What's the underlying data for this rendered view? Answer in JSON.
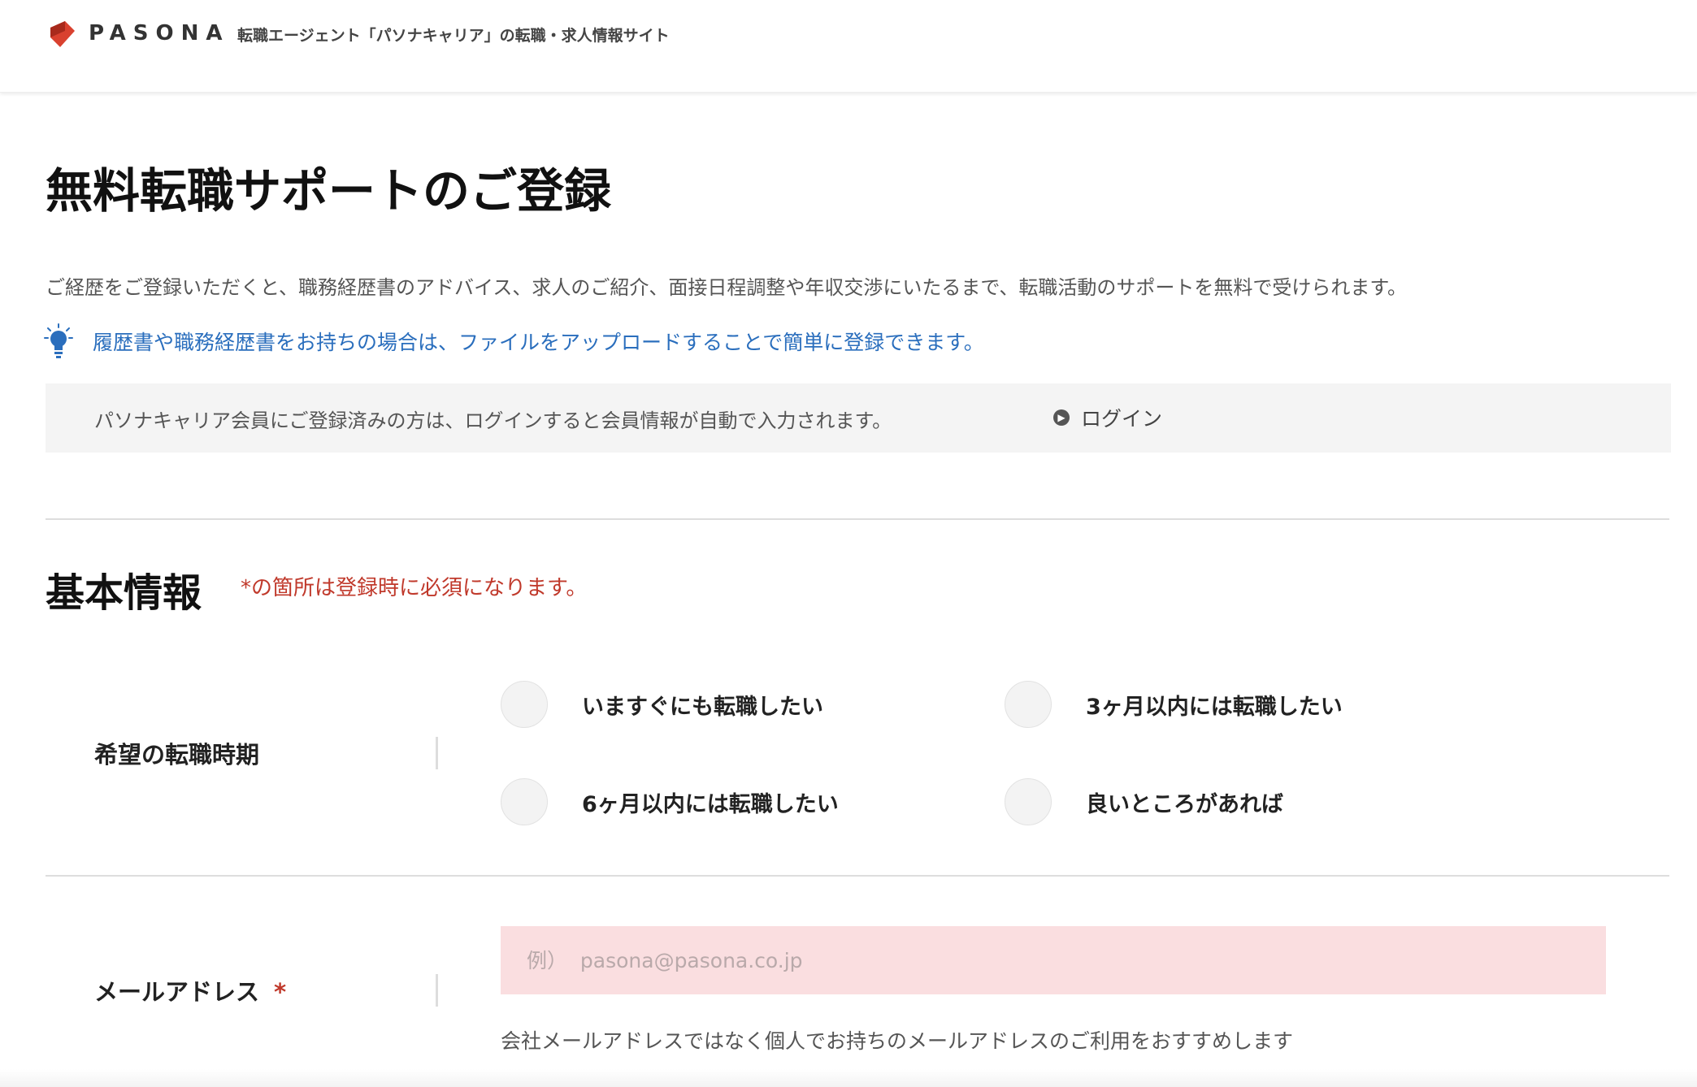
{
  "header": {
    "logo_text": "PASONA",
    "logo_icon": "pasona-logo-mark",
    "tagline": "転職エージェント「パソナキャリア」の転職・求人情報サイト"
  },
  "main": {
    "title": "無料転職サポートのご登録",
    "intro": "ご経歴をご登録いただくと、職務経歴書のアドバイス、求人のご紹介、面接日程調整や年収交渉にいたるまで、転職活動のサポートを無料で受けられます。",
    "tip_icon": "lightbulb-icon",
    "tip_link": "履歴書や職務経歴書をお持ちの場合は、ファイルをアップロードすることで簡単に登録できます。",
    "login_note": "パソナキャリア会員にご登録済みの方は、ログインすると会員情報が自動で入力されます。",
    "login_link": "ログイン"
  },
  "basic_info": {
    "title": "基本情報",
    "required_note": "*の箇所は登録時に必須になります。",
    "timing": {
      "label": "希望の転職時期",
      "options": [
        "いますぐにも転職したい",
        "3ヶ月以内には転職したい",
        "6ヶ月以内には転職したい",
        "良いところがあれば"
      ]
    },
    "email": {
      "label": "メールアドレス",
      "required_mark": "*",
      "placeholder": "例）  pasona@pasona.co.jp",
      "value": "",
      "hint": "会社メールアドレスではなく個人でお持ちのメールアドレスのご利用をおすすめします"
    }
  },
  "colors": {
    "link": "#2a6ebd",
    "required": "#c0392b",
    "logo": "#d9412f",
    "input_error_bg": "#fadee0"
  }
}
